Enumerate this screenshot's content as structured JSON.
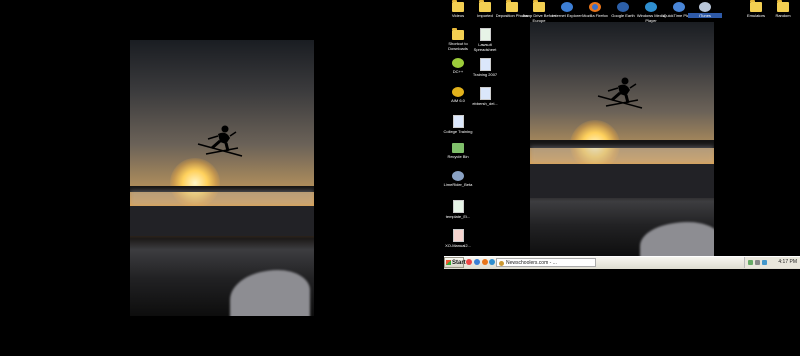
{
  "desktop": {
    "icons": [
      {
        "label": "Videos",
        "type": "folder"
      },
      {
        "label": "Imported",
        "type": "folder"
      },
      {
        "label": "Deposition Photos",
        "type": "folder"
      },
      {
        "label": "Jump Drive Before Europe",
        "type": "folder"
      },
      {
        "label": "Internet Explorer",
        "type": "ie"
      },
      {
        "label": "Mozilla Firefox",
        "type": "firefox"
      },
      {
        "label": "Google Earth",
        "type": "earth"
      },
      {
        "label": "Windows Media Player",
        "type": "wmp"
      },
      {
        "label": "QuickTime Player",
        "type": "quicktime"
      },
      {
        "label": "iTunes",
        "type": "itunes"
      },
      {
        "label": "Emulators",
        "type": "folder"
      },
      {
        "label": "Random",
        "type": "folder"
      },
      {
        "label": "Shortcut to Downloads",
        "type": "folder"
      },
      {
        "label": "Lawsuit Spreadsheet",
        "type": "doc"
      },
      {
        "label": "DC++",
        "type": "dcpp"
      },
      {
        "label": "Training 2007",
        "type": "doc"
      },
      {
        "label": "AIM 6.0",
        "type": "aim"
      },
      {
        "label": "ebbersh_del...",
        "type": "doc"
      },
      {
        "label": "College Training",
        "type": "doc"
      },
      {
        "label": "Recycle Bin",
        "type": "recycle"
      },
      {
        "label": "LimeRider_Beta",
        "type": "app"
      },
      {
        "label": "template_Ei...",
        "type": "doc"
      },
      {
        "label": "XO-Manual2...",
        "type": "pdf"
      }
    ]
  },
  "taskbar": {
    "start_label": "Start",
    "task_item": "Newschoolers.com - ...",
    "clock": "4:17 PM"
  },
  "colors": {
    "sky_glow": "#f6d27a",
    "taskbar": "#ece9d8",
    "folder": "#f3cf52"
  }
}
